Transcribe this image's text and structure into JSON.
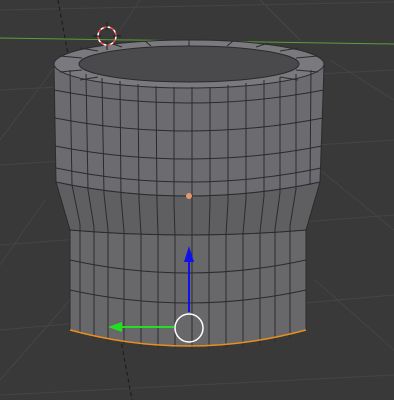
{
  "viewport": {
    "background_color": "#393939",
    "grid_line_color": "#444444",
    "x_axis_color": "#5a9e3a",
    "selection_outline_color": "#e8901e",
    "mesh_face_color": "#6a6a6d",
    "mesh_edge_color": "#2b2b2d",
    "origin_dot_color": "#e39a6a"
  },
  "cursor_3d": {
    "icon": "crosshair-cursor-icon",
    "colors": [
      "#ff4444",
      "#ffffff"
    ]
  },
  "manipulator": {
    "icon": "translate-gizmo-icon",
    "z_axis_color": "#1010ee",
    "y_axis_color": "#20e020",
    "center_ring_color": "#ffffff"
  },
  "mesh": {
    "name": "cylinder-mesh",
    "segments": 32,
    "selected_edge_loop": "bottom"
  }
}
